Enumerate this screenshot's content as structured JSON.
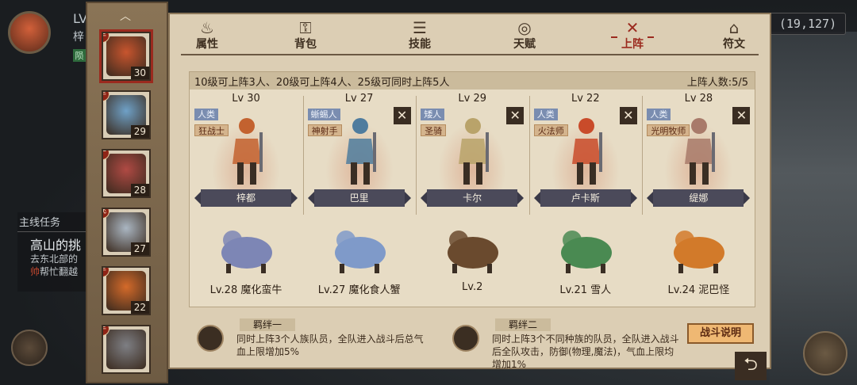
{
  "hud": {
    "lv": "LV",
    "lv2": "梓",
    "green": "陨",
    "coords": "(19,127)",
    "quest_title": "主线任务",
    "quest_name": "高山的挑",
    "quest_text1": "去东北部的",
    "quest_mark": "帅",
    "quest_text2": "帮忙翻越"
  },
  "side": {
    "portraits": [
      {
        "lv": "30",
        "badge": "丰",
        "color": "#c8552e"
      },
      {
        "lv": "29",
        "badge": "丰",
        "color": "#6fa1c7"
      },
      {
        "lv": "28",
        "badge": "十",
        "color": "#b04a44"
      },
      {
        "lv": "27",
        "badge": "飞",
        "color": "#aab6c2"
      },
      {
        "lv": "22",
        "badge": "丰",
        "color": "#d46a2a"
      },
      {
        "lv": "",
        "badge": "丰",
        "color": "#7e7f84"
      }
    ]
  },
  "tabs": [
    {
      "label": "属性",
      "icon": "♨"
    },
    {
      "label": "背包",
      "icon": "⚿"
    },
    {
      "label": "技能",
      "icon": "☰"
    },
    {
      "label": "天赋",
      "icon": "◎"
    },
    {
      "label": "上阵",
      "icon": "✕"
    },
    {
      "label": "符文",
      "icon": "⌂"
    }
  ],
  "board": {
    "rule": "10级可上阵3人、20级可上阵4人、25级可同时上阵5人",
    "count": "上阵人数:5/5"
  },
  "slots": [
    {
      "lv": "Lv 30",
      "race": "人类",
      "cls": "狂战士",
      "name": "梓都",
      "removable": false,
      "pet": "Lv.28 魔化蛮牛",
      "pet_color": "#7d86b5",
      "hero_color": "#c3622f"
    },
    {
      "lv": "Lv 27",
      "race": "蜥蜴人",
      "cls": "神射手",
      "name": "巴里",
      "removable": true,
      "pet": "Lv.27 魔化食人蟹",
      "pet_color": "#7f9ac9",
      "hero_color": "#4f7c9e"
    },
    {
      "lv": "Lv 29",
      "race": "矮人",
      "cls": "圣骑",
      "name": "卡尔",
      "removable": true,
      "pet": "Lv.2 ",
      "pet_color": "#6a4a2e",
      "hero_color": "#b9a36a"
    },
    {
      "lv": "Lv 22",
      "race": "人类",
      "cls": "火法师",
      "name": "卢卡斯",
      "removable": true,
      "pet": "Lv.21 雪人",
      "pet_color": "#4a8a52",
      "hero_color": "#c94b2a"
    },
    {
      "lv": "Lv 28",
      "race": "人类",
      "cls": "光明牧师",
      "name": "缇娜",
      "removable": true,
      "pet": "Lv.24 泥巴怪",
      "pet_color": "#d27a2a",
      "hero_color": "#a87a6a"
    }
  ],
  "bonds": [
    {
      "title": "羁绊一",
      "text": "同时上阵3个人族队员，全队进入战斗后总气血上限增加5%"
    },
    {
      "title": "羁绊二",
      "text": "同时上阵3个不同种族的队员，全队进入战斗后全队攻击，防御(物理,魔法)，气血上限均增加1%"
    }
  ],
  "buttons": {
    "battle_info": "战斗说明",
    "return_icon": "⮌"
  }
}
